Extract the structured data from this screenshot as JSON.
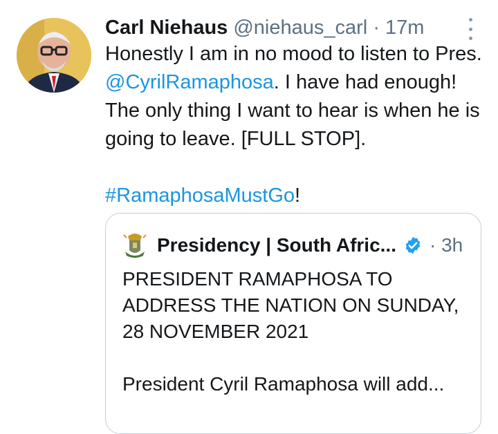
{
  "tweet": {
    "author_name": "Carl Niehaus",
    "author_handle": "@niehaus_carl",
    "separator": "·",
    "time": "17m",
    "text_part1": "Honestly I am in no mood to listen to Pres. ",
    "mention": "@CyrilRamaphosa",
    "text_part2": ". I have had enough! The only thing I want to hear is when he is going to leave. [FULL STOP].",
    "hashtag": "#RamaphosaMustGo",
    "hashtag_suffix": "!"
  },
  "quoted_tweet": {
    "author_name": "Presidency | South Afric...",
    "separator": "·",
    "time": "3h",
    "line1": "PRESIDENT RAMAPHOSA TO ADDRESS THE NATION ON SUNDAY, 28 NOVEMBER 2021",
    "line2": "President Cyril Ramaphosa will add..."
  },
  "icons": {
    "more": "more-vertical-icon",
    "verified": "verified-badge-icon",
    "crest": "coat-of-arms-icon"
  },
  "colors": {
    "link": "#1b95e0",
    "secondary_text": "#5b7083",
    "verified": "#1da1f2"
  }
}
